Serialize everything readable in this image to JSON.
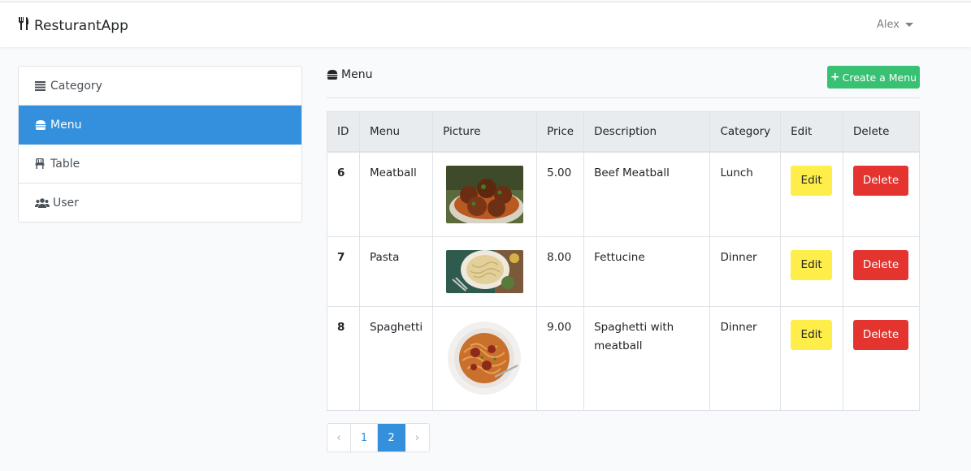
{
  "navbar": {
    "brand": "ResturantApp",
    "user": "Alex"
  },
  "sidebar": {
    "items": [
      {
        "label": "Category",
        "icon": "list-icon",
        "active": false
      },
      {
        "label": "Menu",
        "icon": "hamburger-icon",
        "active": true
      },
      {
        "label": "Table",
        "icon": "chair-icon",
        "active": false
      },
      {
        "label": "User",
        "icon": "users-icon",
        "active": false
      }
    ]
  },
  "main": {
    "title": "Menu",
    "create_label": "Create a Menu",
    "colors": {
      "primary": "#3490dc",
      "success": "#38c172",
      "warning": "#ffed4a",
      "danger": "#e3342f"
    },
    "columns": [
      "ID",
      "Menu",
      "Picture",
      "Price",
      "Description",
      "Category",
      "Edit",
      "Delete"
    ],
    "rows": [
      {
        "id": "6",
        "menu": "Meatball",
        "price": "5.00",
        "description": "Beef Meatball",
        "category": "Lunch",
        "edit": "Edit",
        "delete": "Delete",
        "picture": "meatball"
      },
      {
        "id": "7",
        "menu": "Pasta",
        "price": "8.00",
        "description": "Fettucine",
        "category": "Dinner",
        "edit": "Edit",
        "delete": "Delete",
        "picture": "pasta"
      },
      {
        "id": "8",
        "menu": "Spaghetti",
        "price": "9.00",
        "description": "Spaghetti with meatball",
        "category": "Dinner",
        "edit": "Edit",
        "delete": "Delete",
        "picture": "spaghetti"
      }
    ]
  },
  "pagination": {
    "prev": "‹",
    "pages": [
      "1",
      "2"
    ],
    "current": "2",
    "next": "›"
  }
}
